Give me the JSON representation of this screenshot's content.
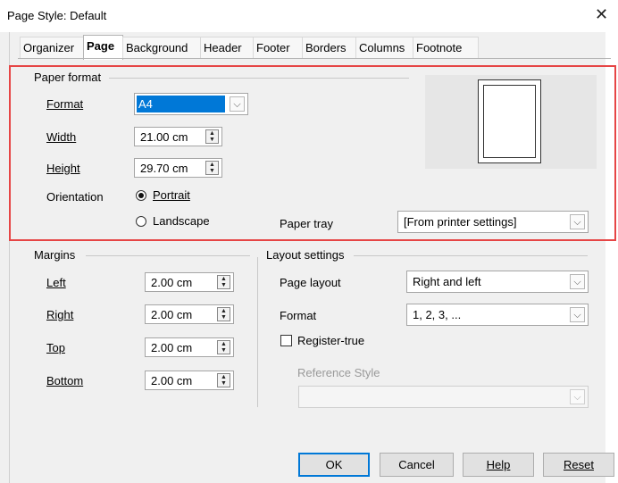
{
  "window": {
    "title": "Page Style: Default",
    "close_glyph": "✕"
  },
  "tabs": [
    "Organizer",
    "Page",
    "Background",
    "Header",
    "Footer",
    "Borders",
    "Columns",
    "Footnote"
  ],
  "active_tab": "Page",
  "paper_format": {
    "section_label": "Paper format",
    "format_label": "Format",
    "format_value": "A4",
    "width_label": "Width",
    "width_value": "21.00 cm",
    "height_label": "Height",
    "height_value": "29.70 cm",
    "orientation_label": "Orientation",
    "portrait_label": "Portrait",
    "landscape_label": "Landscape",
    "orientation_selected": "Portrait",
    "paper_tray_label": "Paper tray",
    "paper_tray_value": "[From printer settings]"
  },
  "margins": {
    "section_label": "Margins",
    "left_label": "Left",
    "left_value": "2.00 cm",
    "right_label": "Right",
    "right_value": "2.00 cm",
    "top_label": "Top",
    "top_value": "2.00 cm",
    "bottom_label": "Bottom",
    "bottom_value": "2.00 cm"
  },
  "layout": {
    "section_label": "Layout settings",
    "page_layout_label": "Page layout",
    "page_layout_value": "Right and left",
    "format_label": "Format",
    "format_value": "1, 2, 3, ...",
    "register_true_label": "Register-true",
    "register_true_checked": false,
    "reference_style_label": "Reference Style",
    "reference_style_value": ""
  },
  "buttons": {
    "ok": "OK",
    "cancel": "Cancel",
    "help": "Help",
    "reset": "Reset"
  },
  "icons": {
    "dropdown": "chevron-down-icon",
    "spin": "spin-updown-icon",
    "close": "close-icon"
  },
  "colors": {
    "highlight_selection": "#0078d7",
    "annotation_box": "#e64545",
    "preview_bg": "#e6e6e6"
  }
}
